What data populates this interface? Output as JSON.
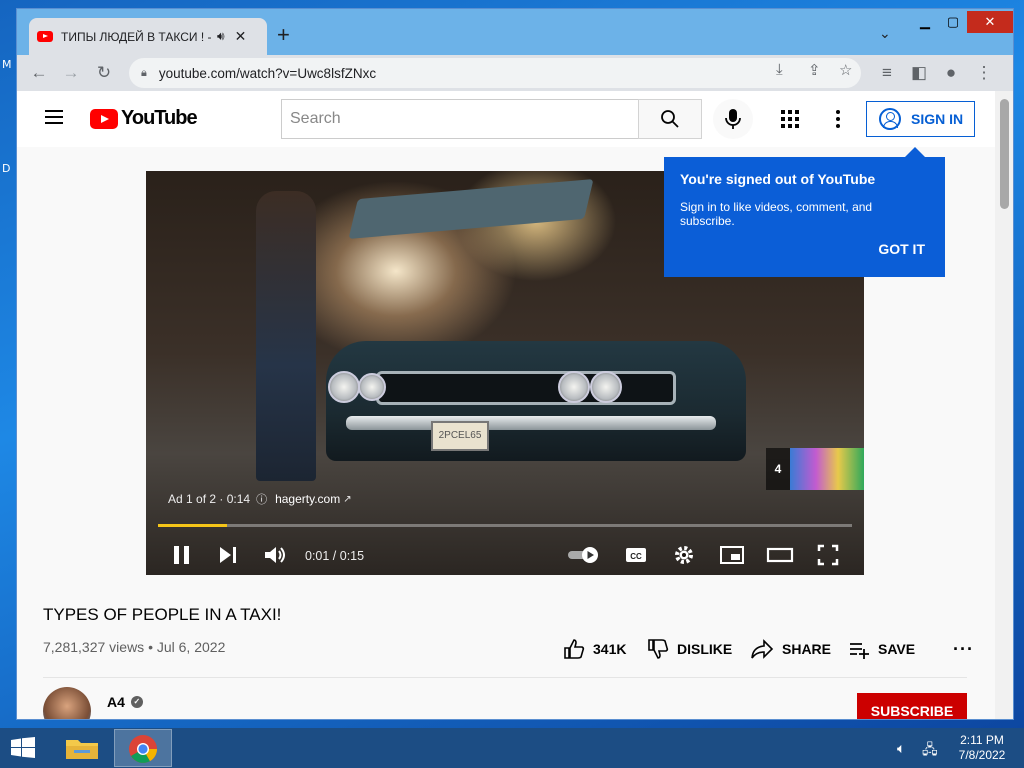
{
  "browser": {
    "tab_title": "ТИПЫ ЛЮДЕЙ В ТАКСИ ! - YouTube",
    "url": "youtube.com/watch?v=Uwc8lsfZNxc"
  },
  "youtube": {
    "logo_text": "YouTube",
    "search_placeholder": "Search",
    "sign_in_label": "SIGN IN"
  },
  "popup": {
    "title": "You're signed out of YouTube",
    "body": "Sign in to like videos, comment, and subscribe.",
    "button": "GOT IT"
  },
  "player": {
    "ad_label": "Ad 1 of 2 · 0:14",
    "ad_link": "hagerty.com",
    "time": "0:01 / 0:15",
    "progress": 0.1,
    "endcard_count": "4",
    "plate_text": "2PCEL65"
  },
  "video": {
    "title": "TYPES OF PEOPLE IN A TAXI!",
    "meta": "7,281,327 views • Jul 6, 2022",
    "likes": "341K",
    "dislike": "DISLIKE",
    "share": "SHARE",
    "save": "SAVE"
  },
  "channel": {
    "name": "A4",
    "subscribe": "SUBSCRIBE"
  },
  "taskbar": {
    "time": "2:11 PM",
    "date": "7/8/2022"
  },
  "colors": {
    "youtube_red": "#ff0000",
    "signin_blue": "#065fd4",
    "popup_blue": "#0b5ed7",
    "progress_yellow": "#f5c518",
    "subscribe_red": "#cc0000"
  },
  "icons": [
    "youtube-favicon",
    "speaker-icon",
    "close-icon",
    "plus-icon",
    "chevron-down-icon",
    "back-icon",
    "forward-icon",
    "reload-icon",
    "lock-icon",
    "install-icon",
    "share-icon",
    "star-icon",
    "reading-list-icon",
    "side-panel-icon",
    "profile-icon",
    "kebab-icon",
    "hamburger-icon",
    "search-icon",
    "mic-icon",
    "apps-icon",
    "avatar-icon",
    "pause-icon",
    "next-icon",
    "volume-icon",
    "autoplay-icon",
    "cc-icon",
    "settings-icon",
    "miniplayer-icon",
    "theater-icon",
    "fullscreen-icon",
    "info-icon",
    "thumbs-up-icon",
    "thumbs-down-icon",
    "share-arrow-icon",
    "playlist-add-icon",
    "verified-icon",
    "windows-start-icon",
    "file-explorer-icon",
    "chrome-icon",
    "volume-muted-icon",
    "network-icon"
  ]
}
